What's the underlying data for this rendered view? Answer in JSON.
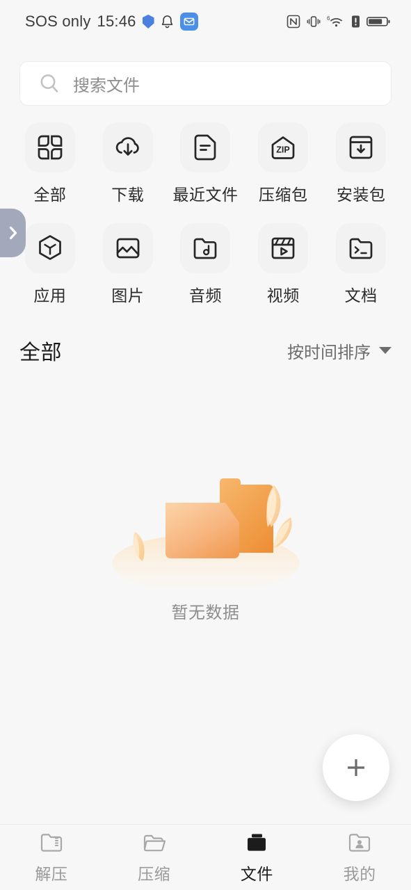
{
  "status_bar": {
    "carrier": "SOS only",
    "time": "15:46",
    "left_icons": [
      "shield-icon",
      "bell-icon",
      "message-app-icon"
    ],
    "right_icons": [
      "nfc-icon",
      "vibrate-icon",
      "wifi-6-icon",
      "alert-icon",
      "battery-icon"
    ],
    "wifi_generation": "6"
  },
  "search": {
    "placeholder": "搜索文件",
    "icon": "search-icon"
  },
  "categories": [
    [
      {
        "label": "全部",
        "icon": "grid-icon"
      },
      {
        "label": "下载",
        "icon": "cloud-download-icon"
      },
      {
        "label": "最近文件",
        "icon": "document-icon"
      },
      {
        "label": "压缩包",
        "icon": "zip-icon",
        "badge_text": "ZIP"
      },
      {
        "label": "安装包",
        "icon": "package-download-icon"
      }
    ],
    [
      {
        "label": "应用",
        "icon": "hexagon-cube-icon"
      },
      {
        "label": "图片",
        "icon": "image-icon"
      },
      {
        "label": "音频",
        "icon": "music-folder-icon"
      },
      {
        "label": "视频",
        "icon": "video-clapperboard-icon"
      },
      {
        "label": "文档",
        "icon": "terminal-folder-icon"
      }
    ]
  ],
  "drawer_handle": {
    "icon": "chevron-right-icon",
    "color": "#a4a8bb"
  },
  "section": {
    "title": "全部",
    "sort_label": "按时间排序",
    "sort_icon": "chevron-down-icon"
  },
  "empty_state": {
    "text": "暂无数据",
    "illustration": "empty-folder-illustration",
    "folder_color": "#f0a04a",
    "folder_front_color": "#f8bd85"
  },
  "fab": {
    "icon": "plus-icon",
    "label": ""
  },
  "bottom_nav": [
    {
      "label": "解压",
      "icon": "unzip-folder-icon",
      "active": false
    },
    {
      "label": "压缩",
      "icon": "zip-folder-icon",
      "active": false
    },
    {
      "label": "文件",
      "icon": "files-folder-icon",
      "active": true
    },
    {
      "label": "我的",
      "icon": "profile-folder-icon",
      "active": false
    }
  ]
}
